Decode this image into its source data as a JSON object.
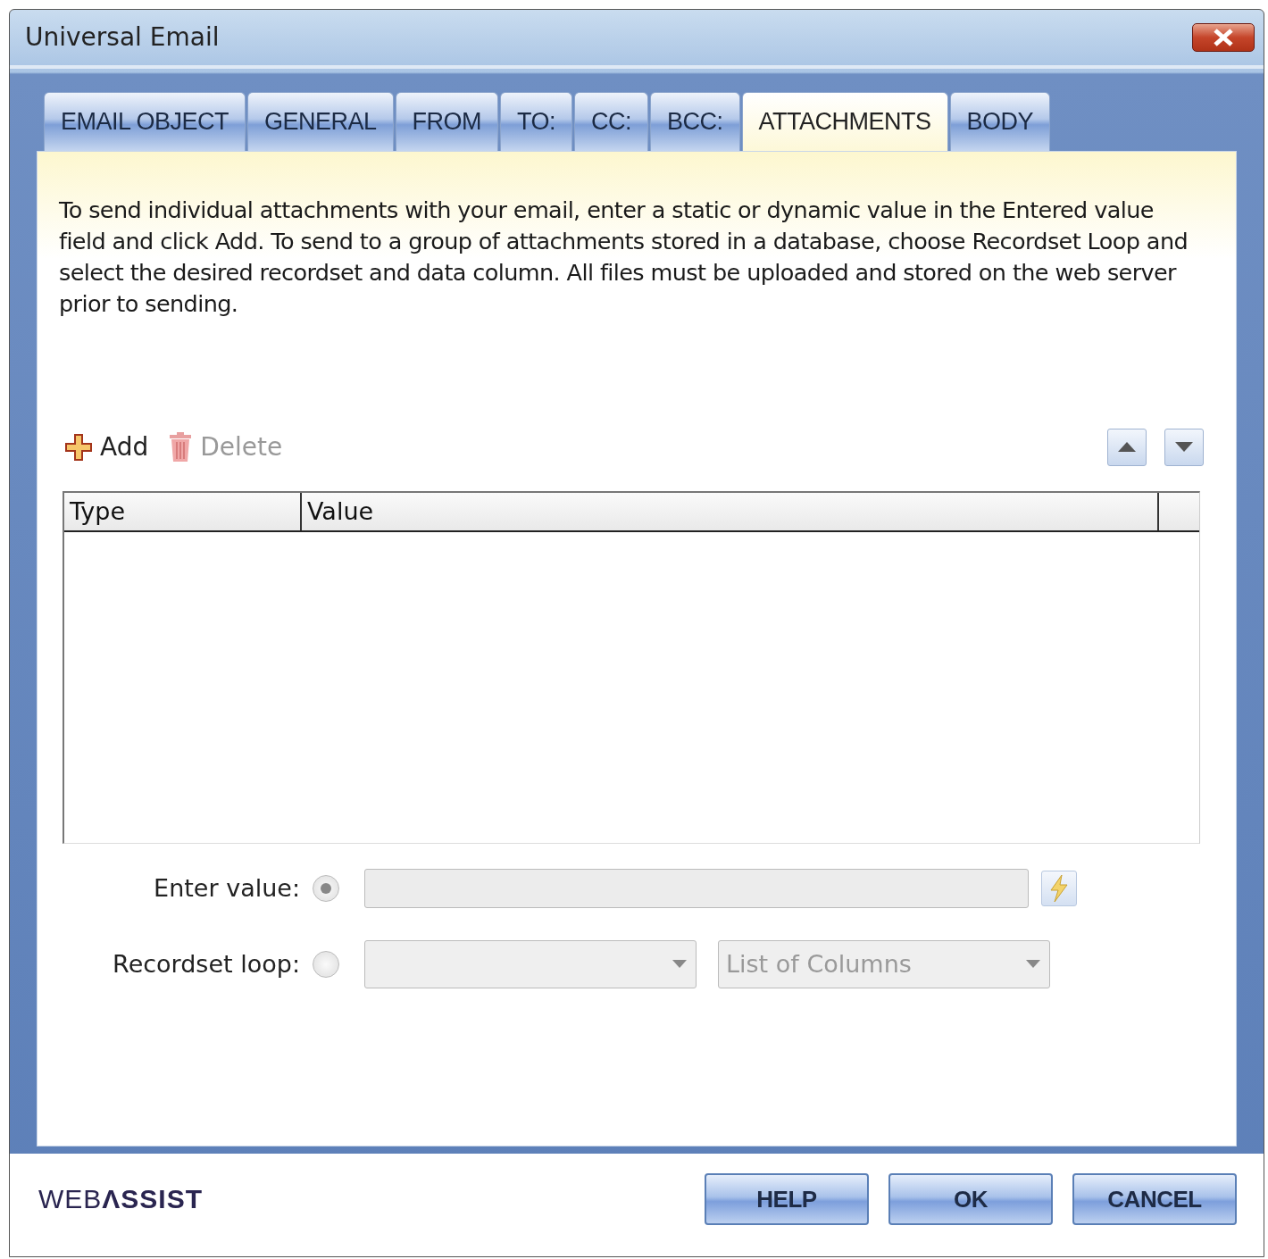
{
  "window": {
    "title": "Universal Email"
  },
  "tabs": [
    {
      "label": "EMAIL OBJECT",
      "selected": false
    },
    {
      "label": "GENERAL",
      "selected": false
    },
    {
      "label": "FROM",
      "selected": false
    },
    {
      "label": "TO:",
      "selected": false
    },
    {
      "label": "CC:",
      "selected": false
    },
    {
      "label": "BCC:",
      "selected": false
    },
    {
      "label": "ATTACHMENTS",
      "selected": true
    },
    {
      "label": "BODY",
      "selected": false
    }
  ],
  "description": "To send individual attachments with your email, enter a static or dynamic value in the Entered value field and click Add. To send to a group of attachments stored in a database, choose Recordset Loop and select the desired recordset and data column. All files must be uploaded and stored on the web server prior to sending.",
  "toolbar": [
    {
      "kind": "add",
      "label": "Add",
      "disabled": false
    },
    {
      "kind": "delete",
      "label": "Delete",
      "disabled": true
    }
  ],
  "table": {
    "columns": [
      "Type",
      "Value"
    ]
  },
  "enter_value": {
    "label": "Enter value:",
    "selected": true
  },
  "recordset_loop": {
    "label": "Recordset loop:",
    "selected": false,
    "columns_placeholder": "List of Columns"
  },
  "logo": "WEB**ΛSSIST**",
  "buttons": [
    "HELP",
    "OK",
    "CANCEL"
  ]
}
